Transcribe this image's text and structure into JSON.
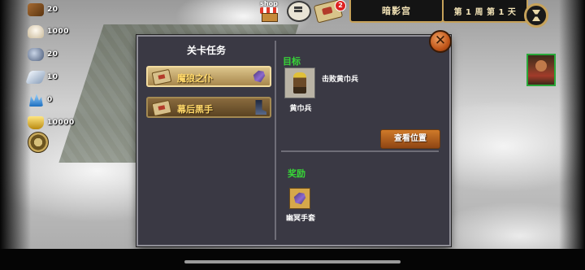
{
  "resources": [
    {
      "name": "wood",
      "icon": "wood-icon",
      "value": "20",
      "color": "#8b5a2b"
    },
    {
      "name": "food",
      "icon": "food-sack-icon",
      "value": "1000",
      "color": "#e8dfc8"
    },
    {
      "name": "iron",
      "icon": "iron-ore-icon",
      "value": "20",
      "color": "#7a8ca8"
    },
    {
      "name": "silver",
      "icon": "silver-ingot-icon",
      "value": "10",
      "color": "#b8c8dc"
    },
    {
      "name": "crystal",
      "icon": "crystal-icon",
      "value": "0",
      "color": "#4aa0e8"
    },
    {
      "name": "gold",
      "icon": "gold-ingot-icon",
      "value": "10000",
      "color": "#e8c040"
    }
  ],
  "topbar": {
    "shop_label": "shop",
    "notification_count": "2",
    "location": "暗影宫",
    "date": "第 1 周  第 1 天"
  },
  "panel": {
    "title": "关卡任务",
    "quests": [
      {
        "label": "魔狼之仆",
        "reward_icon": "glove-icon",
        "active": true
      },
      {
        "label": "幕后黑手",
        "reward_icon": "boot-icon",
        "active": false
      }
    ],
    "goal_label": "目标",
    "goal_text": "击败黄巾兵",
    "enemy_name": "黄巾兵",
    "view_button": "查看位置",
    "reward_label": "奖励",
    "reward_name": "幽冥手套",
    "close_glyph": "✕"
  },
  "colors": {
    "accent_green": "#37d637",
    "panel_bg": "#3a3944",
    "button_orange": "#cf7a2a",
    "quest_active": "#dcc48a",
    "quest_label": "#ffd86a"
  }
}
